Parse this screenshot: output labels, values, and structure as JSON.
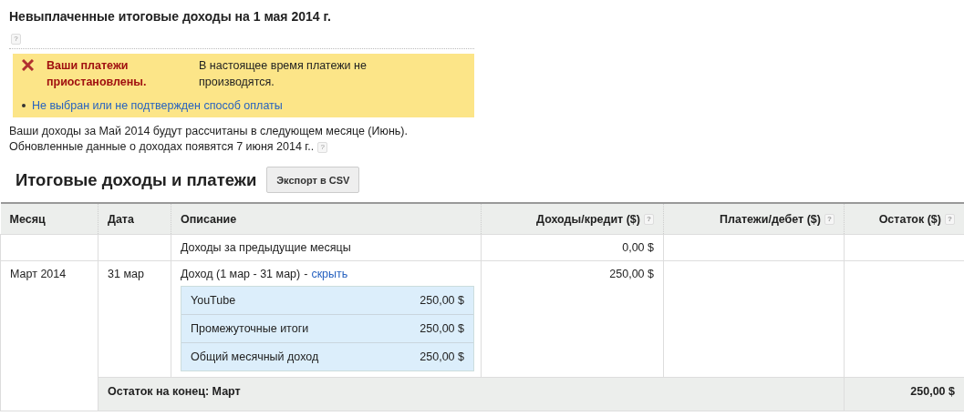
{
  "header": {
    "title": "Невыплаченные итоговые доходы на 1 мая 2014 г.",
    "help": "?"
  },
  "alert": {
    "title": "Ваши платежи приостановлены.",
    "message": "В настоящее время платежи не производятся.",
    "links": [
      "Не выбран или не подтвержден способ оплаты"
    ]
  },
  "note": {
    "lines": [
      "Ваши доходы за Май 2014 будут рассчитаны в следующем месяце (Июнь).",
      "Обновленные данные о доходах появятся 7 июня 2014 г.."
    ],
    "help": "?"
  },
  "section": {
    "title": "Итоговые доходы и платежи",
    "export_button": "Экспорт в CSV"
  },
  "table": {
    "columns": [
      {
        "label": "Месяц"
      },
      {
        "label": "Дата"
      },
      {
        "label": "Описание"
      },
      {
        "label": "Доходы/кредит ($)",
        "help": "?"
      },
      {
        "label": "Платежи/дебет ($)",
        "help": "?"
      },
      {
        "label": "Остаток ($)",
        "help": "?"
      }
    ],
    "rows": [
      {
        "description": "Доходы за предыдущие месяцы",
        "credit": "0,00 $"
      },
      {
        "month": "Март 2014",
        "date": "31 мар",
        "description": "Доход (1 мар - 31 мар)",
        "separator": "-",
        "link": "скрыть",
        "credit": "250,00 $",
        "breakdown": [
          {
            "label": "YouTube",
            "amount": "250,00 $"
          },
          {
            "label": "Промежуточные итоги",
            "amount": "250,00 $"
          },
          {
            "label": "Общий месячный доход",
            "amount": "250,00 $"
          }
        ]
      }
    ],
    "footer": {
      "label": "Остаток на конец: Март",
      "balance": "250,00 $"
    }
  }
}
